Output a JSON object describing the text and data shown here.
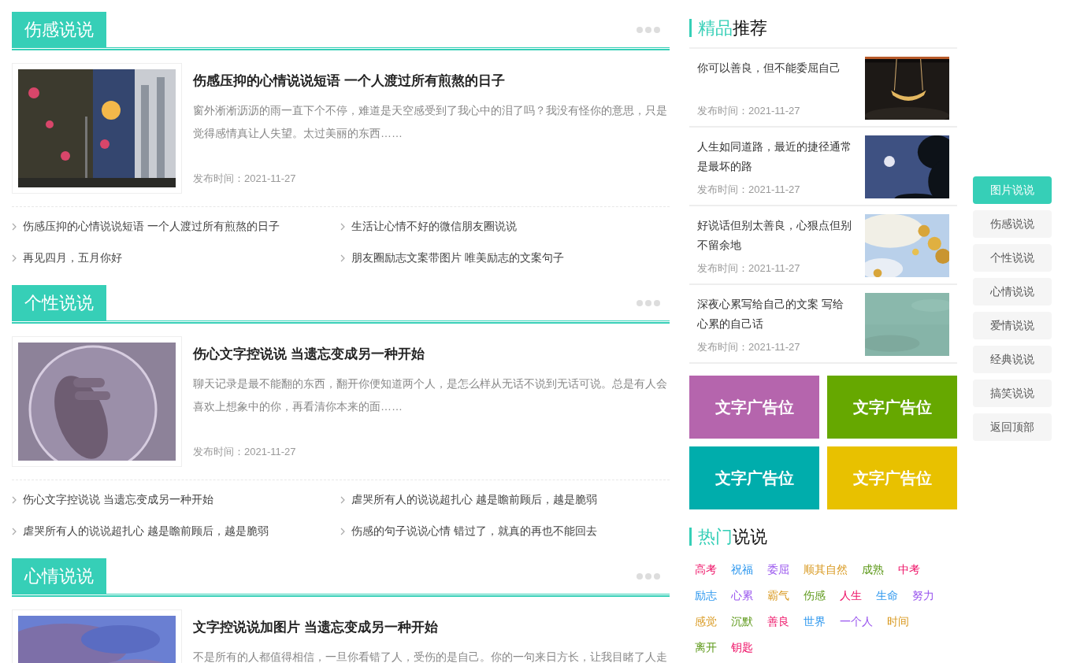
{
  "sections": [
    {
      "title": "伤感说说",
      "featured": {
        "title": "伤感压抑的心情说说短语 一个人渡过所有煎熬的日子",
        "excerpt": "窗外淅淅沥沥的雨一直下个不停，难道是天空感受到了我心中的泪了吗？我没有怪你的意思，只是觉得感情真让人失望。太过美丽的东西……",
        "date": "发布时间：2021-11-27"
      },
      "links": [
        "伤感压抑的心情说说短语 一个人渡过所有煎熬的日子",
        "生活让心情不好的微信朋友圈说说",
        "再见四月，五月你好",
        "朋友圈励志文案带图片 唯美励志的文案句子"
      ]
    },
    {
      "title": "个性说说",
      "featured": {
        "title": "伤心文字控说说 当遗忘变成另一种开始",
        "excerpt": "聊天记录是最不能翻的东西，翻开你便知道两个人，是怎么样从无话不说到无话可说。总是有人会喜欢上想象中的你，再看清你本来的面……",
        "date": "发布时间：2021-11-27"
      },
      "links": [
        "伤心文字控说说 当遗忘变成另一种开始",
        "虐哭所有人的说说超扎心 越是瞻前顾后，越是脆弱",
        "虐哭所有人的说说超扎心 越是瞻前顾后，越是脆弱",
        "伤感的句子说说心情 错过了，就真的再也不能回去"
      ]
    },
    {
      "title": "心情说说",
      "featured": {
        "title": "文字控说说加图片 当遗忘变成另一种开始",
        "excerpt": "不是所有的人都值得相信，一旦你看错了人，受伤的是自己。你的一句来日方长，让我目睹了人走"
      }
    }
  ],
  "recommend": {
    "title_accent": "精品",
    "title_rest": "推荐",
    "items": [
      {
        "title": "你可以善良，但不能委屈自己",
        "date": "发布时间：2021-11-27"
      },
      {
        "title": "人生如同道路，最近的捷径通常是最坏的路",
        "date": "发布时间：2021-11-27"
      },
      {
        "title": "好说话但别太善良，心狠点但别不留余地",
        "date": "发布时间：2021-11-27"
      },
      {
        "title": "深夜心累写给自己的文案 写给心累的自己话",
        "date": "发布时间：2021-11-27"
      }
    ]
  },
  "ads": [
    {
      "label": "文字广告位",
      "color": "#b565ad"
    },
    {
      "label": "文字广告位",
      "color": "#66a800"
    },
    {
      "label": "文字广告位",
      "color": "#00adac"
    },
    {
      "label": "文字广告位",
      "color": "#e8c100"
    }
  ],
  "hot": {
    "title_accent": "热门",
    "title_rest": "说说",
    "tags": [
      {
        "label": "高考",
        "color": "#ee1166"
      },
      {
        "label": "祝福",
        "color": "#2b96ee"
      },
      {
        "label": "委屈",
        "color": "#9955ee"
      },
      {
        "label": "顺其自然",
        "color": "#d99a22"
      },
      {
        "label": "成熟",
        "color": "#5f9a1c"
      },
      {
        "label": "中考",
        "color": "#ee1166"
      },
      {
        "label": "励志",
        "color": "#2b96ee"
      },
      {
        "label": "心累",
        "color": "#9955ee"
      },
      {
        "label": "霸气",
        "color": "#d99a22"
      },
      {
        "label": "伤感",
        "color": "#5f9a1c"
      },
      {
        "label": "人生",
        "color": "#ee1166"
      },
      {
        "label": "生命",
        "color": "#2b96ee"
      },
      {
        "label": "努力",
        "color": "#9955ee"
      },
      {
        "label": "感觉",
        "color": "#d99a22"
      },
      {
        "label": "沉默",
        "color": "#5f9a1c"
      },
      {
        "label": "善良",
        "color": "#ee1166"
      },
      {
        "label": "世界",
        "color": "#2b96ee"
      },
      {
        "label": "一个人",
        "color": "#9955ee"
      },
      {
        "label": "时间",
        "color": "#d99a22"
      },
      {
        "label": "离开",
        "color": "#5f9a1c"
      },
      {
        "label": "钥匙",
        "color": "#ee1166"
      }
    ]
  },
  "float_nav": [
    {
      "label": "图片说说",
      "selected": true
    },
    {
      "label": "伤感说说",
      "selected": false
    },
    {
      "label": "个性说说",
      "selected": false
    },
    {
      "label": "心情说说",
      "selected": false
    },
    {
      "label": "爱情说说",
      "selected": false
    },
    {
      "label": "经典说说",
      "selected": false
    },
    {
      "label": "搞笑说说",
      "selected": false
    },
    {
      "label": "返回顶部",
      "selected": false
    }
  ]
}
